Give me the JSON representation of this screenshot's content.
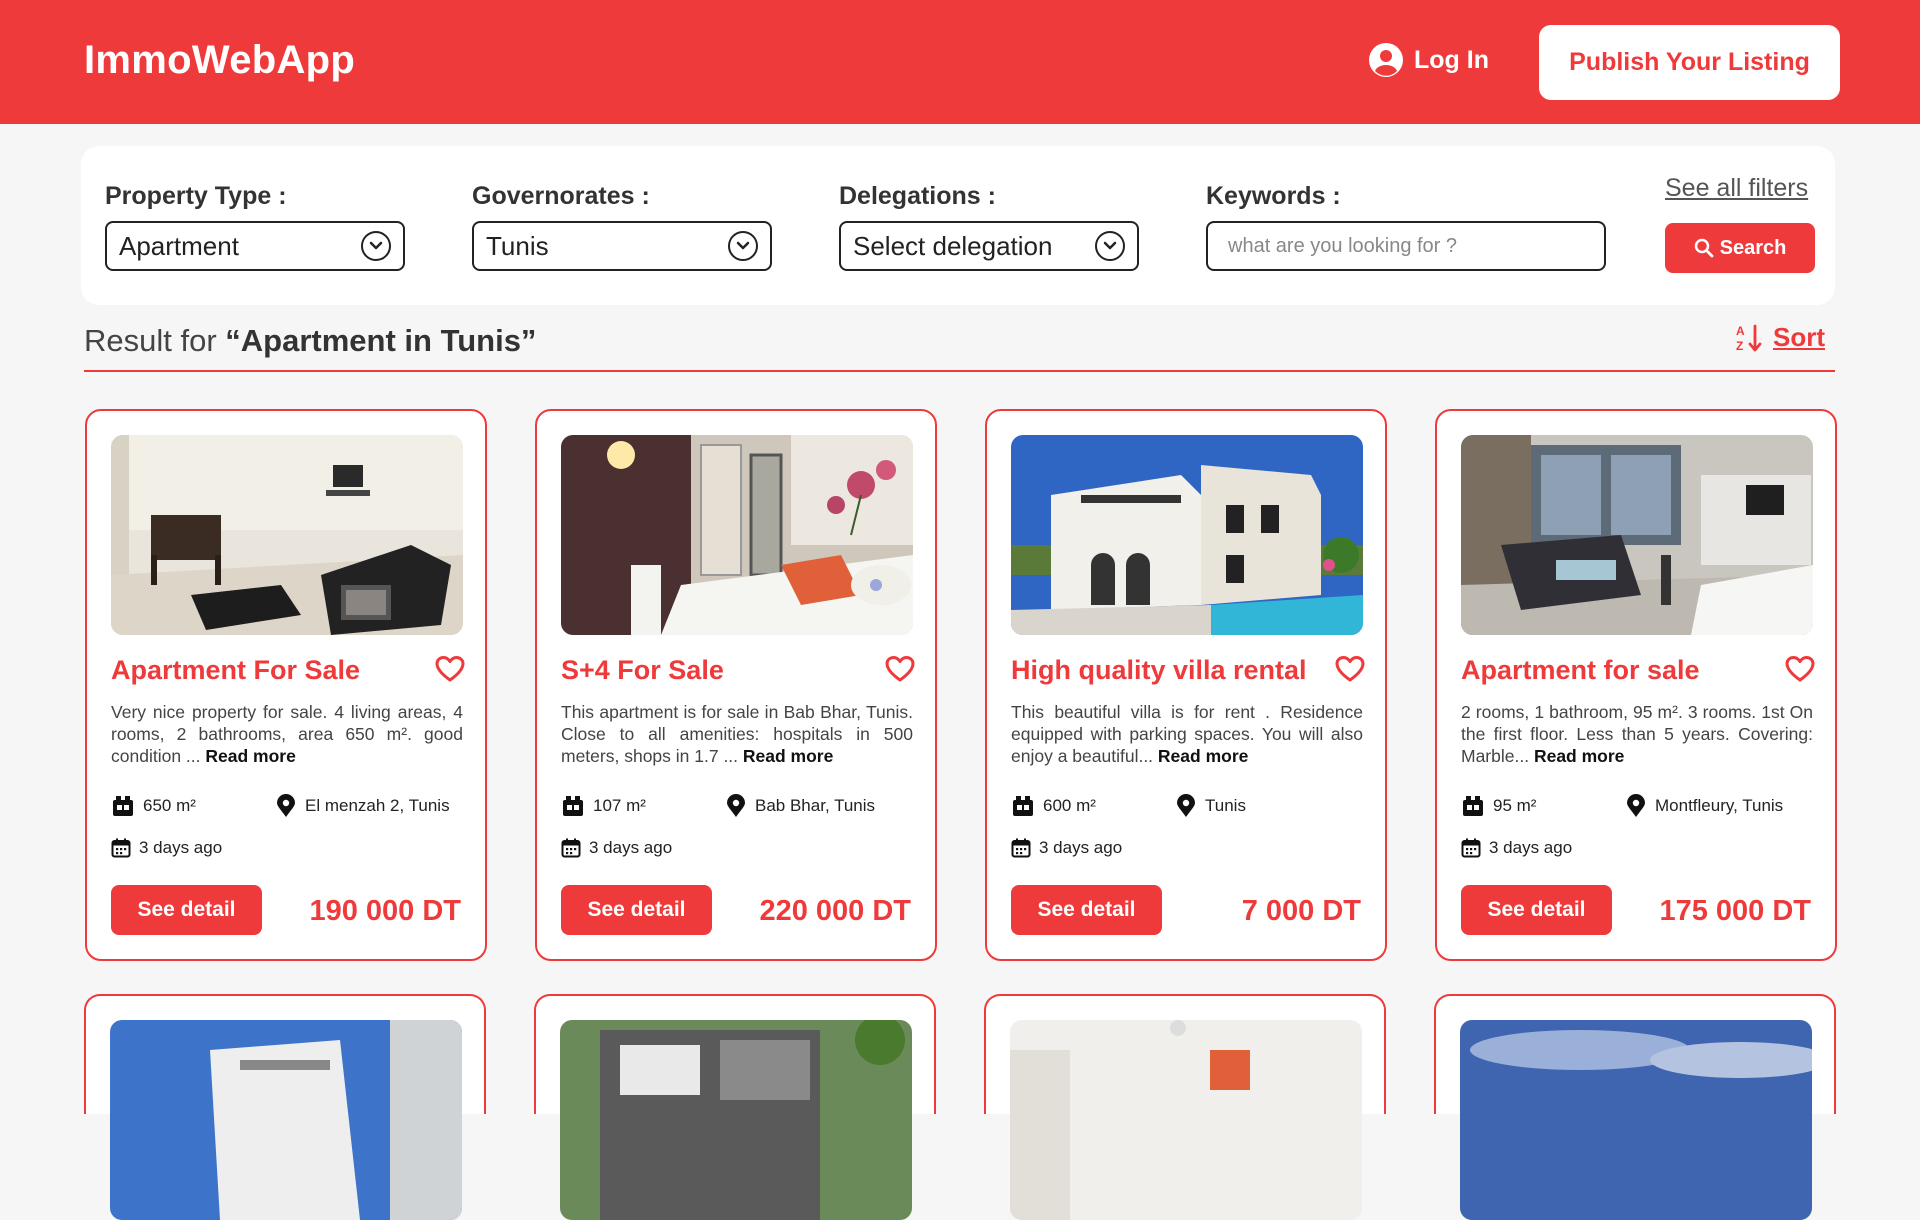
{
  "header": {
    "brand": "ImmoWebApp",
    "login_label": "Log In",
    "publish_label": "Publish Your Listing",
    "accent_color": "#ee3a3a"
  },
  "filters": {
    "property_type": {
      "label": "Property Type :",
      "value": "Apartment"
    },
    "governorates": {
      "label": "Governorates :",
      "value": "Tunis"
    },
    "delegations": {
      "label": "Delegations :",
      "value": "Select delegation"
    },
    "keywords": {
      "label": "Keywords :",
      "placeholder": "what are you looking for ?"
    },
    "see_all_label": "See all filters",
    "search_label": "Search"
  },
  "results": {
    "prefix": "Result for ",
    "query": "“Apartment in Tunis”",
    "sort_label": "Sort"
  },
  "listings": [
    {
      "title": "Apartment  For Sale",
      "description": "Very nice property for sale. 4 living areas, 4 rooms, 2 bathrooms, area 650 m². good condition ...",
      "read_more": "Read more",
      "area": "650 m²",
      "location": "El menzah 2, Tunis",
      "posted": "3 days ago",
      "detail_label": "See detail",
      "price": "190 000 DT"
    },
    {
      "title": "S+4  For Sale",
      "description": "This apartment is for sale in Bab Bhar, Tunis. Close to all amenities: hospitals in 500 meters, shops in 1.7 ...",
      "read_more": "Read more",
      "area": "107 m²",
      "location": "Bab Bhar, Tunis",
      "posted": "3 days ago",
      "detail_label": "See detail",
      "price": "220 000 DT"
    },
    {
      "title": "High quality villa rental",
      "description": "This beautiful villa is for rent . Residence equipped with parking spaces. You will also enjoy a beautiful...",
      "read_more": "Read more",
      "area": "600 m²",
      "location": "Tunis",
      "posted": "3 days ago",
      "detail_label": "See detail",
      "price": "7 000 DT"
    },
    {
      "title": "Apartment for sale",
      "description": "2 rooms, 1 bathroom, 95 m². 3 rooms. 1st On the first floor. Less than 5 years. Covering: Marble...",
      "read_more": "Read more",
      "area": "95 m²",
      "location": "Montfleury, Tunis",
      "posted": "3 days ago",
      "detail_label": "See detail",
      "price": "175 000 DT"
    }
  ]
}
